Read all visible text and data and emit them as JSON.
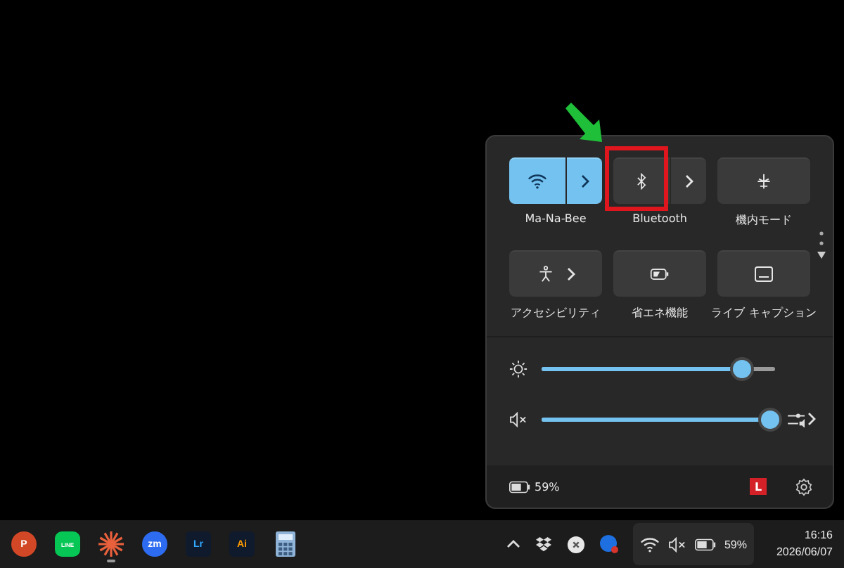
{
  "quick_settings": {
    "tiles": [
      {
        "kind": "split",
        "label": "Ma-Na-Bee",
        "on": true
      },
      {
        "kind": "split",
        "label": "Bluetooth",
        "on": false
      },
      {
        "kind": "toggle",
        "label": "機内モード",
        "on": false
      },
      {
        "kind": "expand",
        "label": "アクセシビリティ",
        "on": false
      },
      {
        "kind": "toggle",
        "label": "省エネ機能",
        "on": false
      },
      {
        "kind": "toggle",
        "label": "ライブ キャプション",
        "on": false
      }
    ],
    "sliders": [
      {
        "kind": "brightness",
        "level": 0.86
      },
      {
        "kind": "volume",
        "level": 0.98,
        "muted": true
      }
    ],
    "footer": {
      "battery": "59%",
      "badge": "L"
    }
  },
  "annotations": [
    {
      "kind": "arrow",
      "color": "#1fbf3a"
    },
    {
      "kind": "highlight",
      "color": "#e0161f"
    }
  ],
  "taskbar": {
    "apps": [
      {
        "kind": "circle",
        "glyph": "P",
        "color": "#d24726",
        "running": false
      },
      {
        "kind": "rounded",
        "glyph": "LINE",
        "color": "#06c755",
        "running": false
      },
      {
        "kind": "burst",
        "color": "#e8603c",
        "running": true
      },
      {
        "kind": "circle",
        "glyph": "zm",
        "color": "#2d6cf0",
        "running": false
      },
      {
        "kind": "square",
        "glyph": "Lr",
        "color": "#31a8ff",
        "running": false
      },
      {
        "kind": "square",
        "glyph": "Ai",
        "color": "#ff9a00",
        "running": false
      },
      {
        "kind": "calculator",
        "color": "#8fb4d8",
        "running": false
      }
    ],
    "tray": {
      "battery": "59%",
      "time": "16:16",
      "date": "2026/06/07",
      "muted": true
    }
  }
}
